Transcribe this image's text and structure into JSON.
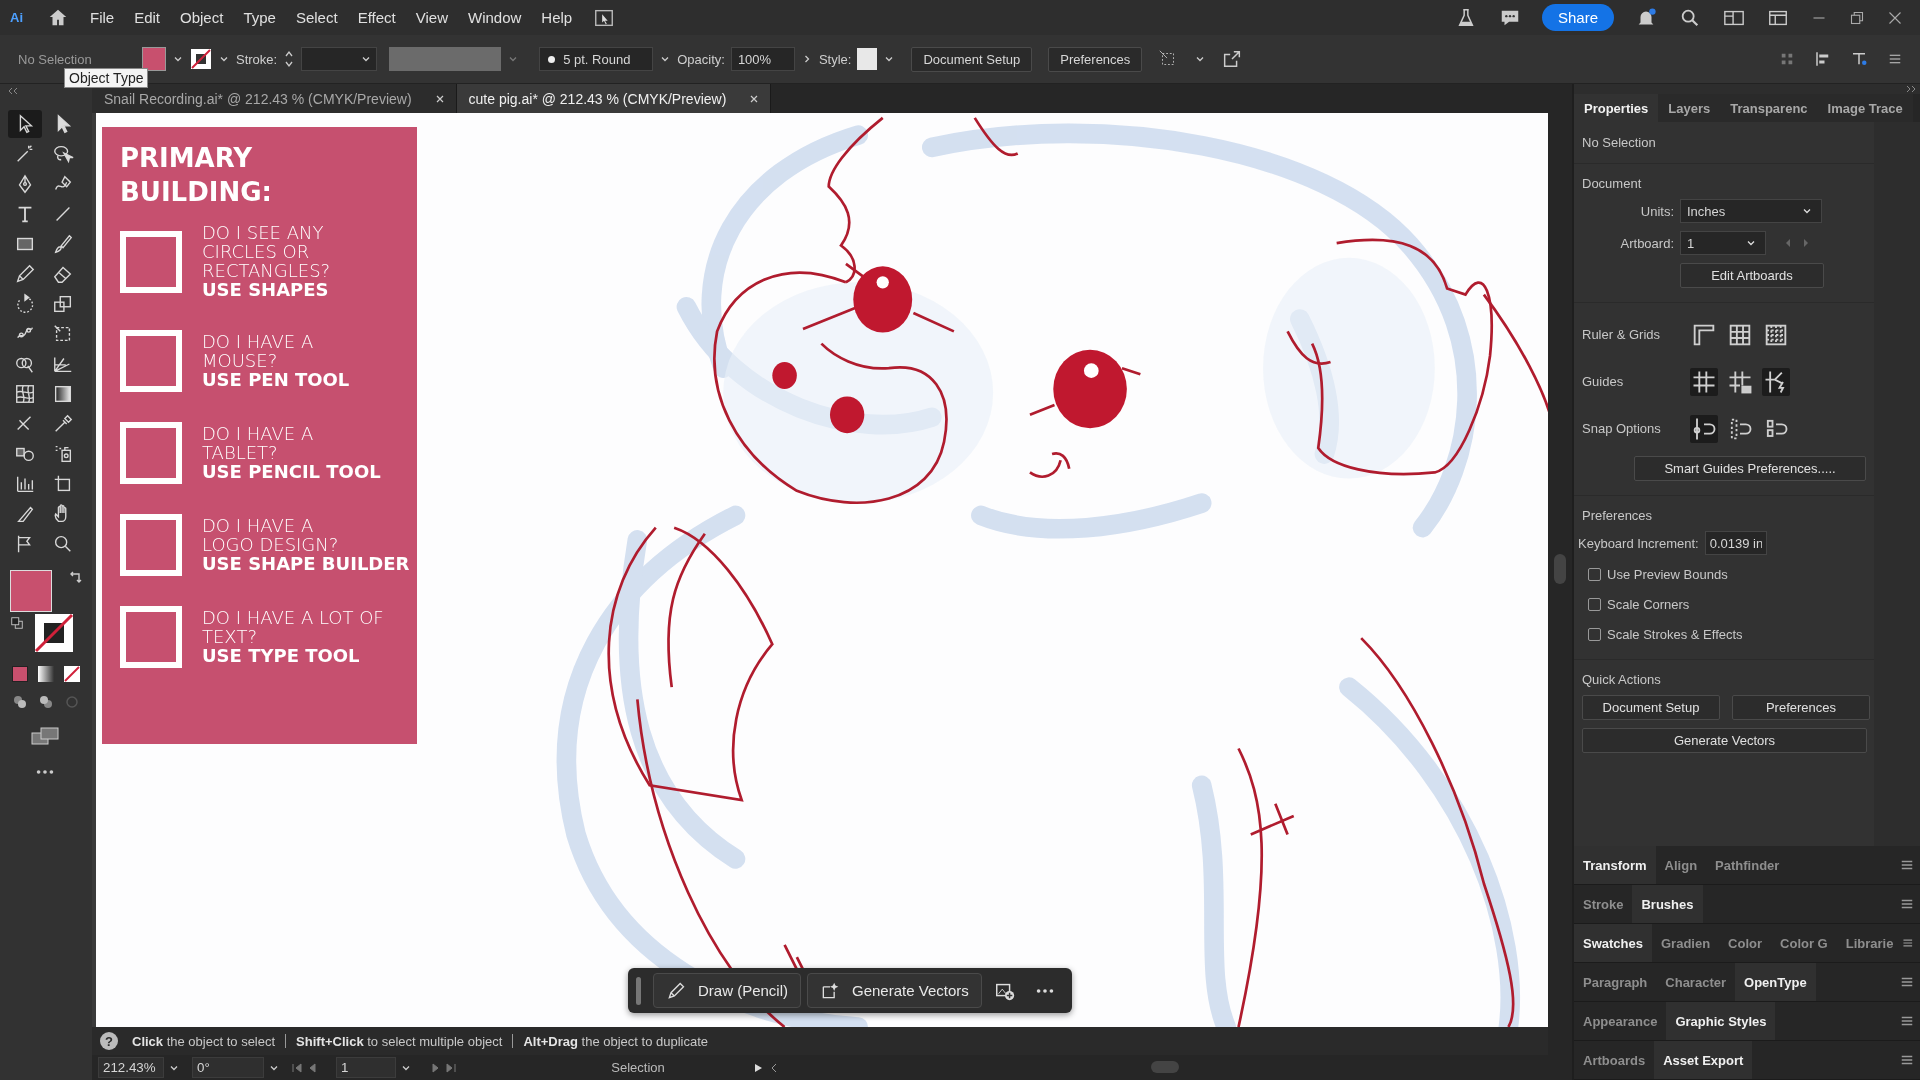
{
  "app_logo": "Ai",
  "menu": [
    "File",
    "Edit",
    "Object",
    "Type",
    "Select",
    "Effect",
    "View",
    "Window",
    "Help"
  ],
  "share_button": "Share",
  "control_bar": {
    "selection": "No Selection",
    "stroke_label": "Stroke:",
    "brush": "5 pt. Round",
    "opacity_label": "Opacity:",
    "opacity": "100%",
    "style_label": "Style:",
    "buttons": [
      "Document Setup",
      "Preferences"
    ]
  },
  "tooltip": "Object Type",
  "document_tabs": [
    {
      "label": "Snail Recording.ai* @ 212.43 % (CMYK/Preview)",
      "selected": false
    },
    {
      "label": "cute pig.ai* @ 212.43 % (CMYK/Preview)",
      "selected": true
    }
  ],
  "tools": [
    {
      "kind": "arrow",
      "selected": true
    },
    {
      "kind": "solid-arrow",
      "selected": false
    },
    {
      "kind": "wand",
      "selected": false
    },
    {
      "kind": "lasso",
      "selected": false
    },
    {
      "kind": "pen-nib",
      "selected": false
    },
    {
      "kind": "curve-pen",
      "selected": false
    },
    {
      "kind": "type-t",
      "selected": false
    },
    {
      "kind": "line",
      "selected": false
    },
    {
      "kind": "rectangle",
      "selected": false
    },
    {
      "kind": "brush",
      "selected": false
    },
    {
      "kind": "pencil",
      "selected": false
    },
    {
      "kind": "eraser",
      "selected": false
    },
    {
      "kind": "rotate",
      "selected": false
    },
    {
      "kind": "scale",
      "selected": false
    },
    {
      "kind": "puppet-warp",
      "selected": false
    },
    {
      "kind": "transform-box",
      "selected": false
    },
    {
      "kind": "shape-builder",
      "selected": false
    },
    {
      "kind": "grid-plane",
      "selected": false
    },
    {
      "kind": "mesh",
      "selected": false
    },
    {
      "kind": "gradient",
      "selected": false
    },
    {
      "kind": "width-tool",
      "selected": false
    },
    {
      "kind": "eyedropper",
      "selected": false
    },
    {
      "kind": "blend",
      "selected": false
    },
    {
      "kind": "sprayer",
      "selected": false
    },
    {
      "kind": "bar-chart",
      "selected": false
    },
    {
      "kind": "artboard",
      "selected": false
    },
    {
      "kind": "knife",
      "selected": false
    },
    {
      "kind": "hand",
      "selected": false
    },
    {
      "kind": "flag",
      "selected": false
    },
    {
      "kind": "zoom",
      "selected": false
    }
  ],
  "artboard_card": {
    "title": "PRIMARY BUILDING:",
    "items": [
      {
        "question": "DO I SEE ANY CIRCLES OR RECTANGLES?",
        "answer": "USE SHAPES"
      },
      {
        "question": "DO I HAVE A MOUSE?",
        "answer": "USE PEN TOOL"
      },
      {
        "question": "DO I HAVE A TABLET?",
        "answer": "USE PENCIL TOOL"
      },
      {
        "question": "DO I HAVE A LOGO DESIGN?",
        "answer": "USE SHAPE BUILDER"
      },
      {
        "question": "DO I HAVE A LOT OF TEXT?",
        "answer": "USE TYPE TOOL"
      }
    ]
  },
  "taskbar": {
    "buttons": [
      "Draw (Pencil)",
      "Generate Vectors"
    ]
  },
  "properties_panel": {
    "tabs": [
      {
        "label": "Properties",
        "selected": true
      },
      {
        "label": "Layers",
        "selected": false
      },
      {
        "label": "Transparenc",
        "selected": false
      },
      {
        "label": "Image Trace",
        "selected": false
      }
    ],
    "selection": "No Selection",
    "document_heading": "Document",
    "units_label": "Units:",
    "units": "Inches",
    "artboard_label": "Artboard:",
    "artboard": "1",
    "edit_artboards": "Edit Artboards",
    "ruler_grids_label": "Ruler & Grids",
    "ruler_grids": [
      {
        "kind": "ruler",
        "on": false
      },
      {
        "kind": "grid",
        "on": false
      },
      {
        "kind": "checker",
        "on": false
      }
    ],
    "guides_label": "Guides",
    "guides": [
      {
        "kind": "guides",
        "on": true
      },
      {
        "kind": "lock-guides",
        "on": false
      },
      {
        "kind": "smart-guides",
        "on": true
      }
    ],
    "snap_label": "Snap Options",
    "snap": [
      {
        "kind": "snap-point",
        "on": true
      },
      {
        "kind": "snap-pixel",
        "on": false
      },
      {
        "kind": "snap-glyph",
        "on": false
      }
    ],
    "smart_guides_button": "Smart Guides Preferences.....",
    "preferences_heading": "Preferences",
    "keyboard_increment_label": "Keyboard Increment:",
    "keyboard_increment": "0.0139 in",
    "checkboxes": [
      {
        "label": "Use Preview Bounds",
        "checked": false
      },
      {
        "label": "Scale Corners",
        "checked": false
      },
      {
        "label": "Scale Strokes & Effects",
        "checked": false
      }
    ],
    "quick_actions_heading": "Quick Actions",
    "quick_actions": [
      "Document Setup",
      "Preferences",
      "Generate Vectors"
    ]
  },
  "panel_groups": [
    {
      "tabs": [
        {
          "label": "Transform",
          "selected": true
        },
        {
          "label": "Align",
          "selected": false
        },
        {
          "label": "Pathfinder",
          "selected": false
        }
      ]
    },
    {
      "tabs": [
        {
          "label": "Stroke",
          "selected": false
        },
        {
          "label": "Brushes",
          "selected": true
        }
      ]
    },
    {
      "tabs": [
        {
          "label": "Swatches",
          "selected": true
        },
        {
          "label": "Gradien",
          "selected": false
        },
        {
          "label": "Color",
          "selected": false
        },
        {
          "label": "Color G",
          "selected": false
        },
        {
          "label": "Librarie",
          "selected": false
        }
      ]
    },
    {
      "tabs": [
        {
          "label": "Paragraph",
          "selected": false
        },
        {
          "label": "Character",
          "selected": false
        },
        {
          "label": "OpenType",
          "selected": true
        }
      ]
    },
    {
      "tabs": [
        {
          "label": "Appearance",
          "selected": false
        },
        {
          "label": "Graphic Styles",
          "selected": true
        }
      ]
    },
    {
      "tabs": [
        {
          "label": "Artboards",
          "selected": false
        },
        {
          "label": "Asset Export",
          "selected": true
        }
      ]
    }
  ],
  "status_bar": {
    "help": "?",
    "hints": [
      "**Click** the object to select",
      "**Shift+Click** to select multiple object",
      "**Alt+Drag** the object to duplicate"
    ]
  },
  "bottom_bar": {
    "zoom": "212.43%",
    "rotation": "0°",
    "artboard": "1",
    "tool": "Selection"
  }
}
